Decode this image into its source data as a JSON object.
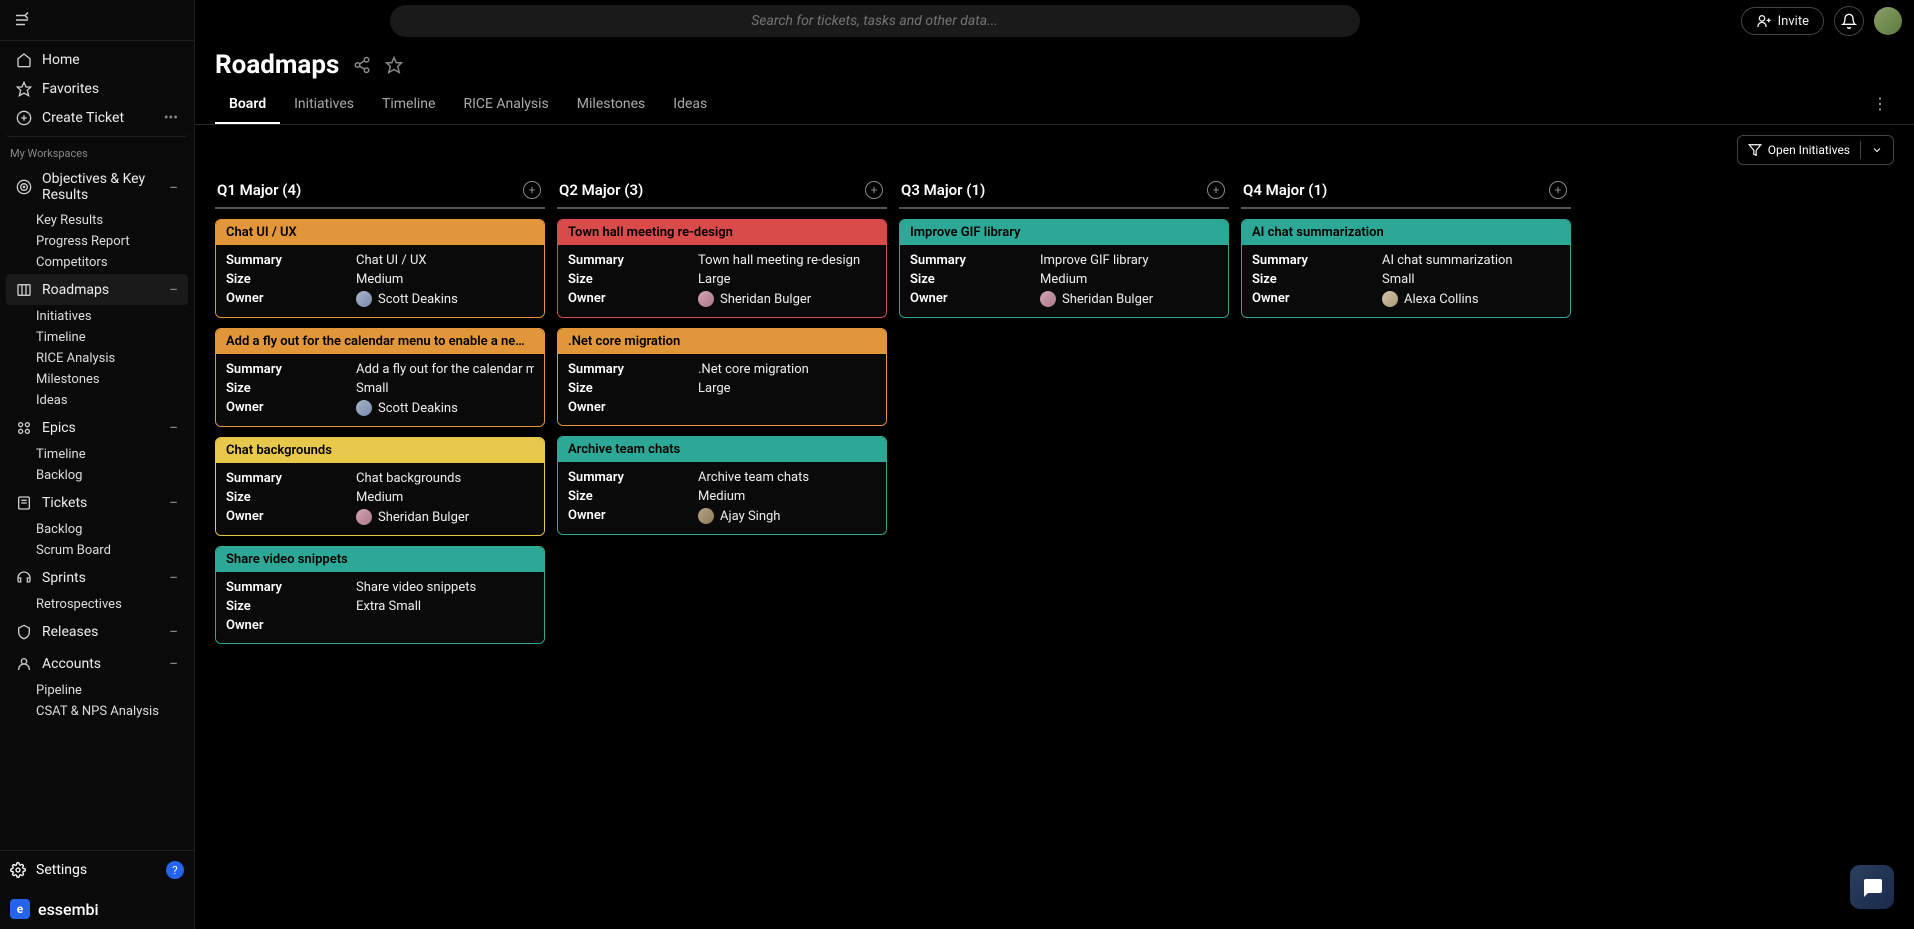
{
  "topbar": {
    "search_placeholder": "Search for tickets, tasks and other data...",
    "invite": "Invite"
  },
  "sidebar": {
    "home": "Home",
    "favorites": "Favorites",
    "create": "Create Ticket",
    "workspaces_label": "My Workspaces",
    "groups": [
      {
        "label": "Objectives & Key Results",
        "items": [
          "Key Results",
          "Progress Report",
          "Competitors"
        ]
      },
      {
        "label": "Roadmaps",
        "items": [
          "Initiatives",
          "Timeline",
          "RICE Analysis",
          "Milestones",
          "Ideas"
        ]
      },
      {
        "label": "Epics",
        "items": [
          "Timeline",
          "Backlog"
        ]
      },
      {
        "label": "Tickets",
        "items": [
          "Backlog",
          "Scrum Board"
        ]
      },
      {
        "label": "Sprints",
        "items": [
          "Retrospectives"
        ]
      },
      {
        "label": "Releases",
        "items": []
      },
      {
        "label": "Accounts",
        "items": [
          "Pipeline",
          "CSAT & NPS Analysis"
        ]
      }
    ],
    "settings": "Settings",
    "brand": "essembi"
  },
  "page": {
    "title": "Roadmaps",
    "tabs": [
      "Board",
      "Initiatives",
      "Timeline",
      "RICE Analysis",
      "Milestones",
      "Ideas"
    ],
    "filter": "Open Initiatives"
  },
  "labels": {
    "summary": "Summary",
    "size": "Size",
    "owner": "Owner"
  },
  "columns": [
    {
      "title": "Q1 Major (4)",
      "cards": [
        {
          "color": "orange",
          "title": "Chat UI / UX",
          "summary": "Chat UI / UX",
          "size": "Medium",
          "owner": "Scott Deakins",
          "av": "scott"
        },
        {
          "color": "orange",
          "title": "Add a fly out for the calendar menu to enable a new meeting t…",
          "summary": "Add a fly out for the calendar menu t…",
          "size": "Small",
          "owner": "Scott Deakins",
          "av": "scott"
        },
        {
          "color": "yellow",
          "title": "Chat backgrounds",
          "summary": "Chat backgrounds",
          "size": "Medium",
          "owner": "Sheridan Bulger",
          "av": "sheridan"
        },
        {
          "color": "teal",
          "title": "Share video snippets",
          "summary": "Share video snippets",
          "size": "Extra Small",
          "owner": "",
          "av": ""
        }
      ]
    },
    {
      "title": "Q2 Major (3)",
      "cards": [
        {
          "color": "red",
          "title": "Town hall meeting re-design",
          "summary": "Town hall meeting re-design",
          "size": "Large",
          "owner": "Sheridan Bulger",
          "av": "sheridan"
        },
        {
          "color": "orange",
          "title": ".Net core migration",
          "summary": ".Net core migration",
          "size": "Large",
          "owner": "",
          "av": ""
        },
        {
          "color": "teal",
          "title": "Archive team chats",
          "summary": "Archive team chats",
          "size": "Medium",
          "owner": "Ajay Singh",
          "av": "ajay"
        }
      ]
    },
    {
      "title": "Q3 Major (1)",
      "cards": [
        {
          "color": "teal",
          "title": "Improve GIF library",
          "summary": "Improve GIF library",
          "size": "Medium",
          "owner": "Sheridan Bulger",
          "av": "sheridan"
        }
      ]
    },
    {
      "title": "Q4 Major (1)",
      "cards": [
        {
          "color": "teal",
          "title": "AI chat summarization",
          "summary": "AI chat summarization",
          "size": "Small",
          "owner": "Alexa Collins",
          "av": "alexa"
        }
      ]
    }
  ]
}
